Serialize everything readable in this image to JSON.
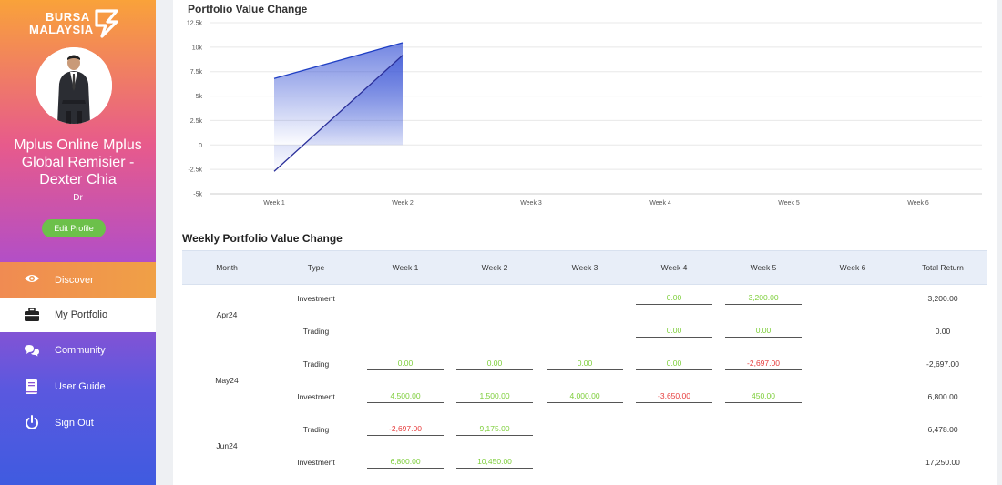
{
  "brand": {
    "line1": "BURSA",
    "line2": "MALAYSIA"
  },
  "profile": {
    "name": "Mplus Online Mplus Global Remisier - Dexter Chia",
    "title": "Dr",
    "edit_label": "Edit Profile"
  },
  "nav": [
    {
      "label": "Discover",
      "icon": "eye-icon"
    },
    {
      "label": "My Portfolio",
      "icon": "briefcase-icon"
    },
    {
      "label": "Community",
      "icon": "chat-icon"
    },
    {
      "label": "User Guide",
      "icon": "book-icon"
    },
    {
      "label": "Sign Out",
      "icon": "power-icon"
    }
  ],
  "colors": {
    "positive": "#7dce3a",
    "negative": "#e63c3c",
    "accent": "#3f5be0"
  },
  "chart_data": {
    "type": "area",
    "title": "Portfolio Value Change",
    "categories": [
      "Week 1",
      "Week 2",
      "Week 3",
      "Week 4",
      "Week 5",
      "Week 6"
    ],
    "y_ticks": [
      "12.5k",
      "10k",
      "7.5k",
      "5k",
      "2.5k",
      "0",
      "-2.5k",
      "-5k"
    ],
    "ylim": [
      -5000,
      12500
    ],
    "series": [
      {
        "values": [
          6800,
          10450
        ]
      },
      {
        "values": [
          -2697,
          9175
        ]
      }
    ],
    "grid": true
  },
  "table": {
    "title": "Weekly Portfolio Value Change",
    "headers": [
      "Month",
      "Type",
      "Week 1",
      "Week 2",
      "Week 3",
      "Week 4",
      "Week 5",
      "Week 6",
      "Total Return"
    ],
    "groups": [
      {
        "month": "Apr24",
        "rows": [
          {
            "type": "Investment",
            "weeks": [
              null,
              null,
              null,
              "0.00",
              "3,200.00",
              null
            ],
            "total": "3,200.00"
          },
          {
            "type": "Trading",
            "weeks": [
              null,
              null,
              null,
              "0.00",
              "0.00",
              null
            ],
            "total": "0.00"
          }
        ]
      },
      {
        "month": "May24",
        "rows": [
          {
            "type": "Trading",
            "weeks": [
              "0.00",
              "0.00",
              "0.00",
              "0.00",
              "-2,697.00",
              null
            ],
            "total": "-2,697.00"
          },
          {
            "type": "Investment",
            "weeks": [
              "4,500.00",
              "1,500.00",
              "4,000.00",
              "-3,650.00",
              "450.00",
              null
            ],
            "total": "6,800.00"
          }
        ]
      },
      {
        "month": "Jun24",
        "rows": [
          {
            "type": "Trading",
            "weeks": [
              "-2,697.00",
              "9,175.00",
              null,
              null,
              null,
              null
            ],
            "total": "6,478.00"
          },
          {
            "type": "Investment",
            "weeks": [
              "6,800.00",
              "10,450.00",
              null,
              null,
              null,
              null
            ],
            "total": "17,250.00"
          }
        ]
      }
    ]
  }
}
